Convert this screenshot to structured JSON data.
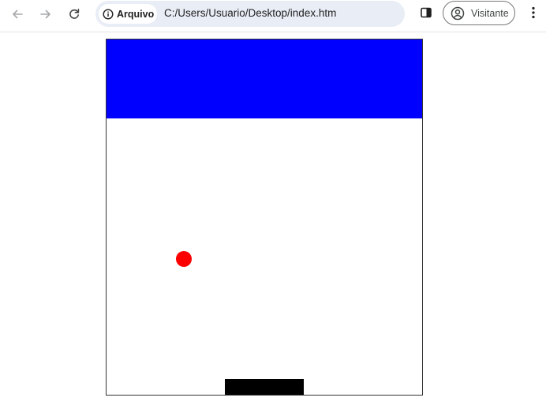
{
  "browser": {
    "site_chip_label": "Arquivo",
    "url": "C:/Users/Usuario/Desktop/index.htm",
    "profile_label": "Visitante",
    "icons": {
      "back": "arrow-left-icon",
      "forward": "arrow-right-icon",
      "reload": "reload-icon",
      "site_info": "info-icon",
      "side_panel": "side-panel-icon",
      "profile": "account-circle-icon",
      "menu": "more-vert-icon"
    }
  },
  "game": {
    "colors": {
      "brick": "#0000ff",
      "ball": "#ff0000",
      "paddle": "#000000",
      "canvas_border": "#333333",
      "background": "#ffffff"
    }
  }
}
